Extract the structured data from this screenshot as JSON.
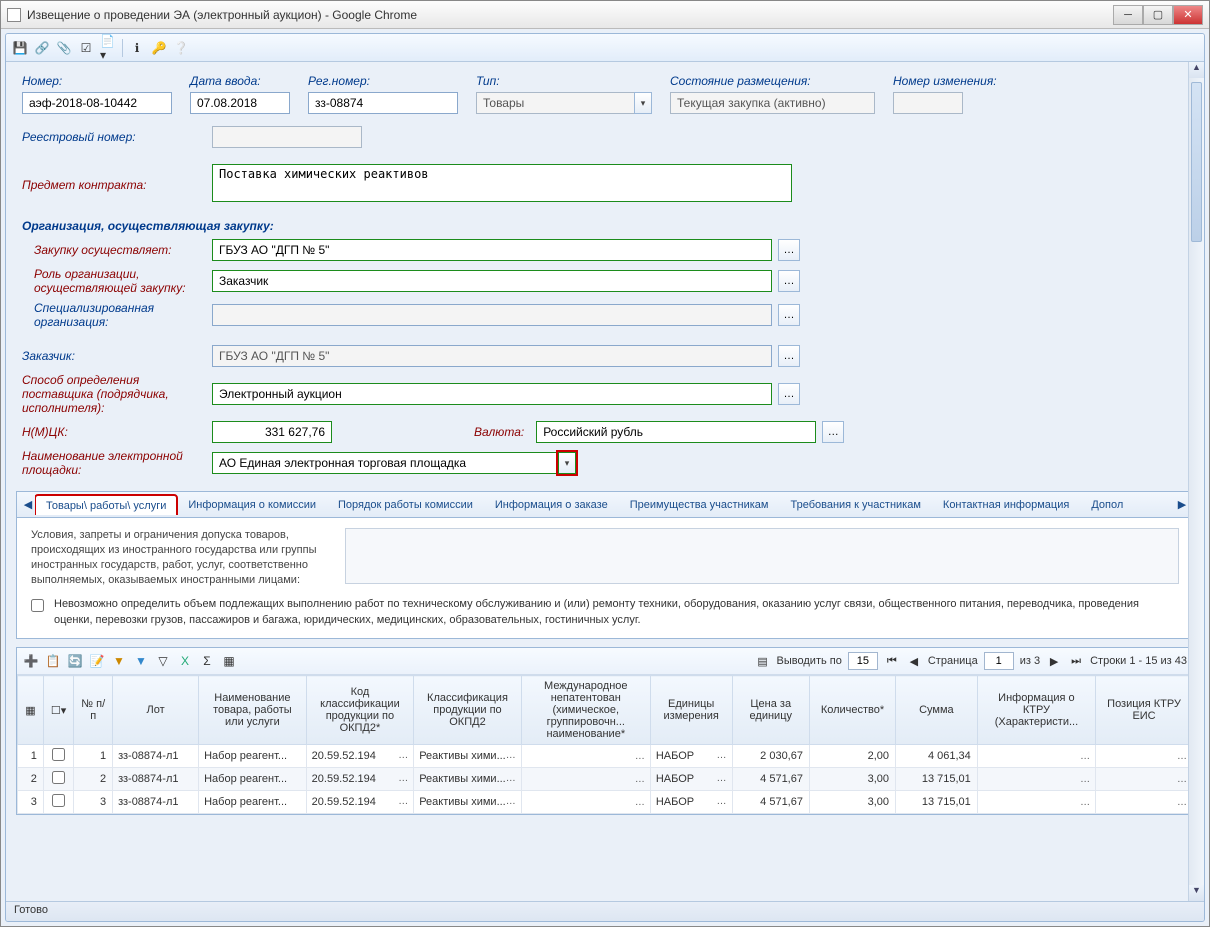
{
  "window": {
    "title": "Извещение о проведении ЭА (электронный аукцион) - Google Chrome"
  },
  "toolbar_icons": [
    "save",
    "link",
    "attach",
    "box-check",
    "doc-down",
    "spacer",
    "info",
    "key",
    "help"
  ],
  "header_fields": {
    "number_label": "Номер:",
    "number_value": "аэф-2018-08-10442",
    "date_label": "Дата ввода:",
    "date_value": "07.08.2018",
    "regnum_label": "Рег.номер:",
    "regnum_value": "зз-08874",
    "type_label": "Тип:",
    "type_value": "Товары",
    "state_label": "Состояние размещения:",
    "state_value": "Текущая закупка (активно)",
    "change_label": "Номер изменения:",
    "change_value": ""
  },
  "form": {
    "registry_label": "Реестровый номер:",
    "registry_value": "",
    "subject_label": "Предмет контракта:",
    "subject_value": "Поставка химических реактивов",
    "org_section": "Организация, осуществляющая закупку:",
    "purchaser_label": "Закупку осуществляет:",
    "purchaser_value": "ГБУЗ АО \"ДГП № 5\"",
    "role_label": "Роль организации, осуществляющей закупку:",
    "role_value": "Заказчик",
    "spec_label": "Специализированная организация:",
    "spec_value": "",
    "customer_label": "Заказчик:",
    "customer_value": "ГБУЗ АО \"ДГП № 5\"",
    "method_label": "Способ определения поставщика (подрядчика, исполнителя):",
    "method_value": "Электронный аукцион",
    "nmck_label": "Н(М)ЦК:",
    "nmck_value": "331 627,76",
    "currency_label": "Валюта:",
    "currency_value": "Российский рубль",
    "platform_label": "Наименование электронной площадки:",
    "platform_value": "АО Единая электронная торговая площадка"
  },
  "tabs": {
    "items": [
      "Товары\\ работы\\ услуги",
      "Информация о комиссии",
      "Порядок работы комиссии",
      "Информация о заказе",
      "Преимущества участникам",
      "Требования к участникам",
      "Контактная информация",
      "Допол"
    ],
    "active_index": 0,
    "desc_left": "Условия, запреты и ограничения допуска товаров, происходящих из иностранного государства или группы иностранных государств, работ, услуг, соответственно выполняемых, оказываемых иностранными лицами:",
    "chk_text": "Невозможно определить объем подлежащих выполнению работ по техническому обслуживанию и (или) ремонту техники, оборудования, оказанию услуг связи, общественного питания, переводчика, проведения оценки, перевозки грузов, пассажиров и багажа, юридических, медицинских, образовательных, гостиничных услуг."
  },
  "grid_toolbar": {
    "output_by_label": "Выводить по",
    "output_by_value": "15",
    "page_label": "Страница",
    "page_value": "1",
    "page_of": "из 3",
    "rows_info": "Строки 1 - 15 из 43"
  },
  "grid": {
    "columns": [
      "",
      "",
      "№ п/п",
      "Лот",
      "Наименование товара, работы или услуги",
      "Код классификации продукции по ОКПД2*",
      "Классификация продукции по ОКПД2",
      "Международное непатентован (химическое, группировочн... наименование*",
      "Единицы измерения",
      "Цена за единицу",
      "Количество*",
      "Сумма",
      "Информация о КТРУ (Характеристи...",
      "Позиция КТРУ ЕИС"
    ],
    "rows": [
      {
        "n": "1",
        "npp": "1",
        "lot": "зз-08874-л1",
        "name": "Набор реагент...",
        "okpd": "20.59.52.194",
        "okpd_name": "Реактивы хими...",
        "intl": "",
        "unit": "НАБОР",
        "price": "2 030,67",
        "qty": "2,00",
        "sum": "4 061,34",
        "ktru": "",
        "ktru_pos": ""
      },
      {
        "n": "2",
        "npp": "2",
        "lot": "зз-08874-л1",
        "name": "Набор реагент...",
        "okpd": "20.59.52.194",
        "okpd_name": "Реактивы хими...",
        "intl": "",
        "unit": "НАБОР",
        "price": "4 571,67",
        "qty": "3,00",
        "sum": "13 715,01",
        "ktru": "",
        "ktru_pos": ""
      },
      {
        "n": "3",
        "npp": "3",
        "lot": "зз-08874-л1",
        "name": "Набор реагент...",
        "okpd": "20.59.52.194",
        "okpd_name": "Реактивы хими...",
        "intl": "",
        "unit": "НАБОР",
        "price": "4 571,67",
        "qty": "3,00",
        "sum": "13 715,01",
        "ktru": "",
        "ktru_pos": ""
      }
    ]
  },
  "status": "Готово"
}
